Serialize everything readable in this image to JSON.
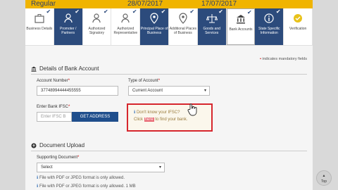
{
  "topbar": {
    "left": "Regular",
    "date1": "28/07/2017",
    "date2": "17/07/2017"
  },
  "steps": [
    {
      "label": "Business Details",
      "state": "done",
      "icon": "briefcase-icon"
    },
    {
      "label": "Promoter / Partners",
      "state": "done",
      "icon": "person-icon"
    },
    {
      "label": "Authorized Signatory",
      "state": "done",
      "icon": "user-icon"
    },
    {
      "label": "Authorized Representative",
      "state": "done",
      "icon": "user-icon"
    },
    {
      "label": "Principal Place of Business",
      "state": "done",
      "icon": "map-pin-icon"
    },
    {
      "label": "Additional Places of Business",
      "state": "done",
      "icon": "map-pin-icon"
    },
    {
      "label": "Goods and Services",
      "state": "done",
      "icon": "scale-icon"
    },
    {
      "label": "Bank Accounts",
      "state": "current",
      "icon": "bank-icon"
    },
    {
      "label": "State Specific Information",
      "state": "done",
      "icon": "info-icon"
    },
    {
      "label": "Verification",
      "state": "pending",
      "icon": "check-circle-icon"
    }
  ],
  "mandatory_note": "indicates mandatory fields",
  "bank_section": {
    "title": "Details of Bank Account",
    "account_number_label": "Account Number",
    "account_number_value": "37748994444455555",
    "account_type_label": "Type of Account",
    "account_type_value": "Current Account",
    "ifsc_label": "Enter Bank IFSC",
    "ifsc_placeholder": "Enter IFSC B",
    "get_address_button": "GET ADDRESS",
    "ifsc_help_line1": "Don't know your IFSC?",
    "ifsc_help_click": "Click",
    "ifsc_help_link": "here",
    "ifsc_help_rest": "to find your bank."
  },
  "upload_section": {
    "title": "Document Upload",
    "supporting_doc_label": "Supporting Document",
    "supporting_doc_value": "Select",
    "note1": "File with PDF or JPEG format is only allowed.",
    "note2": "File with PDF or JPEG format is only allowed. 1 MB"
  },
  "top_button": "Top",
  "colors": {
    "brand_navy": "#2c4b7c",
    "topbar_yellow": "#f0b400",
    "error_red": "#d6262e",
    "button_blue": "#1f4e8c"
  }
}
